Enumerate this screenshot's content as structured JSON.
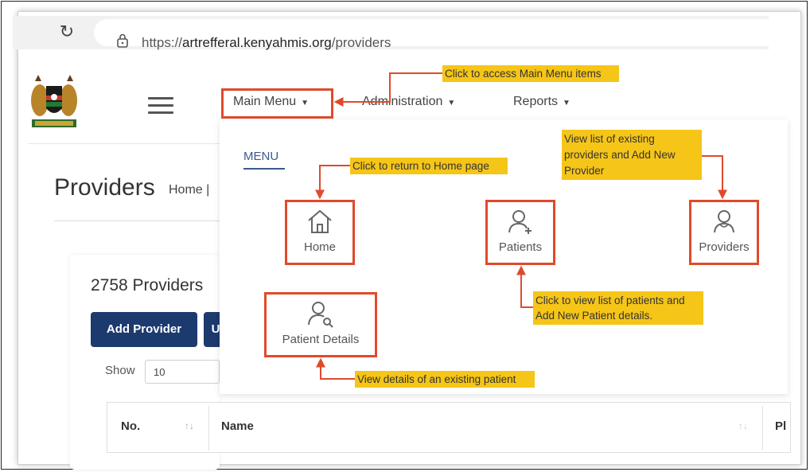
{
  "browser": {
    "url_prefix": "https://",
    "url_domain": "artrefferal.kenyahmis.org",
    "url_path": "/providers"
  },
  "header": {
    "nav": [
      {
        "label": "Main Menu"
      },
      {
        "label": "Administration"
      },
      {
        "label": "Reports"
      }
    ]
  },
  "menu": {
    "tab_label": "MENU",
    "tiles": {
      "home": "Home",
      "patients": "Patients",
      "providers": "Providers",
      "patient_details": "Patient Details"
    }
  },
  "page": {
    "title": "Providers",
    "breadcrumb": "Home |",
    "count_text": "2758 Providers",
    "add_button": "Add Provider",
    "upload_button": "U",
    "show_label": "Show",
    "show_value": "10",
    "table_headers": [
      "No.",
      "Name",
      "Pl"
    ]
  },
  "annotations": {
    "main_menu": "Click to access Main Menu items",
    "home": "Click to return to Home page",
    "providers": "View list of existing providers and Add New Provider",
    "patients": "Click to view list of patients and Add New Patient details.",
    "patient_details": "View details of an existing patient"
  },
  "colors": {
    "annotation_fill": "#f5c518",
    "annotation_border": "#e04a2b",
    "primary_button": "#1d3a6e",
    "menu_tab": "#3c5a8a"
  },
  "icons": [
    "reload-icon",
    "lock-icon",
    "kenya-coat-of-arms-logo",
    "hamburger-icon",
    "home-icon",
    "patient-add-icon",
    "provider-icon",
    "patient-search-icon",
    "sort-icon"
  ]
}
